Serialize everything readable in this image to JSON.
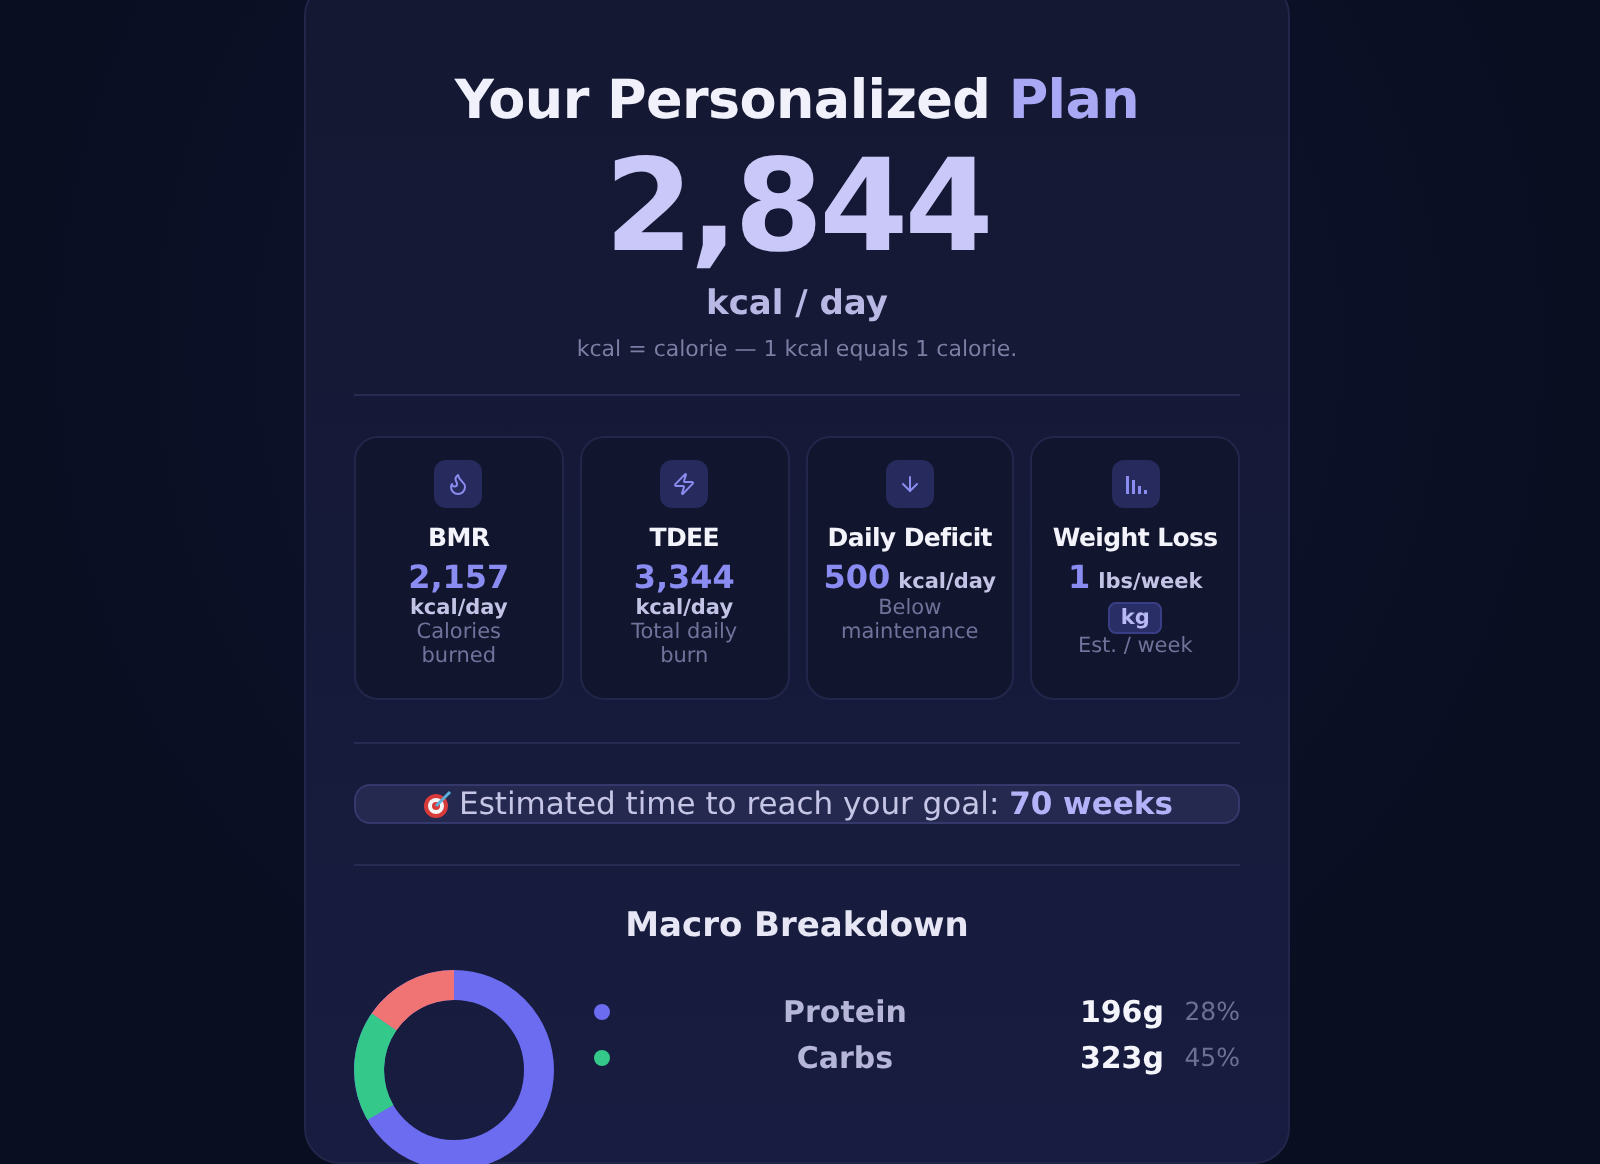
{
  "plan": {
    "title_start": "Your Personalized",
    "title_end": "Plan",
    "calories": "2,844",
    "unit": "kcal / day",
    "note": "kcal = calorie — 1 kcal equals 1 calorie."
  },
  "stats": [
    {
      "kind": "flame",
      "title": "BMR",
      "value": "2,157",
      "unit": "kcal/day",
      "unit_beside": false,
      "note": "Calories burned"
    },
    {
      "kind": "bolt",
      "title": "TDEE",
      "value": "3,344",
      "unit": "kcal/day",
      "unit_beside": false,
      "note": "Total daily burn"
    },
    {
      "kind": "down",
      "title": "Daily Deficit",
      "value": "500",
      "unit": "kcal/day",
      "unit_beside": true,
      "note": "Below maintenance"
    },
    {
      "kind": "bars",
      "title": "Weight Loss",
      "value": "1",
      "unit": "lbs/week",
      "unit_beside": true,
      "toggle": "kg",
      "note": "Est. / week"
    }
  ],
  "goal": {
    "text": "Estimated time to reach your goal: **70 weeks**"
  },
  "macros": {
    "title": "Macro Breakdown",
    "items": [
      {
        "name": "Protein",
        "grams": "196g",
        "percent": "28%",
        "color": "#6c6cf0"
      },
      {
        "name": "Carbs",
        "grams": "323g",
        "percent": "45%",
        "color": "#34c98a"
      }
    ]
  }
}
